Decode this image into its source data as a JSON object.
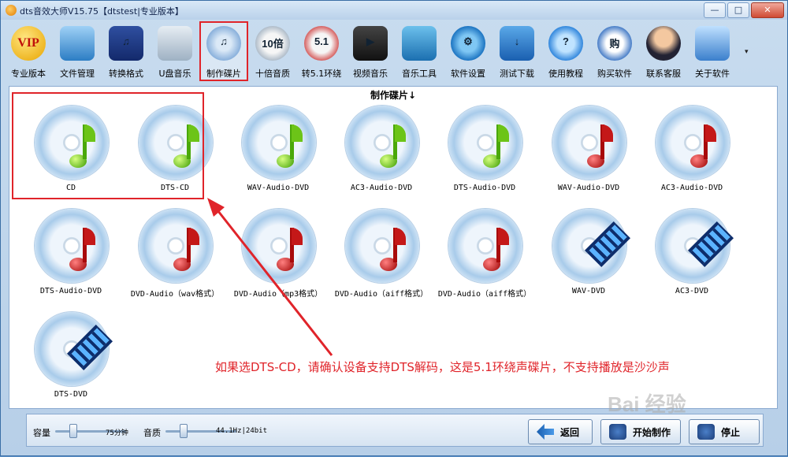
{
  "window": {
    "title": "dts音效大师V15.75【dtstest|专业版本】",
    "min_label": "—",
    "max_label": "□",
    "close_label": "✕"
  },
  "toolbar": {
    "items": [
      {
        "label": "专业版本",
        "icon": "vip-icon",
        "glyph": "VIP"
      },
      {
        "label": "文件管理",
        "icon": "folder-icon",
        "glyph": ""
      },
      {
        "label": "转换格式",
        "icon": "music-file-icon",
        "glyph": "♫"
      },
      {
        "label": "U盘音乐",
        "icon": "usb-icon",
        "glyph": ""
      },
      {
        "label": "制作碟片",
        "icon": "cd-music-icon",
        "glyph": "♫"
      },
      {
        "label": "十倍音质",
        "icon": "ten-times-icon",
        "glyph": "10倍"
      },
      {
        "label": "转5.1环绕",
        "icon": "surround-51-icon",
        "glyph": "5.1"
      },
      {
        "label": "视频音乐",
        "icon": "clapper-icon",
        "glyph": "▶"
      },
      {
        "label": "音乐工具",
        "icon": "tools-icon",
        "glyph": ""
      },
      {
        "label": "软件设置",
        "icon": "gear-icon",
        "glyph": "⚙"
      },
      {
        "label": "测试下载",
        "icon": "download-icon",
        "glyph": "↓"
      },
      {
        "label": "使用教程",
        "icon": "help-icon",
        "glyph": "?"
      },
      {
        "label": "购买软件",
        "icon": "buy-icon",
        "glyph": "购"
      },
      {
        "label": "联系客服",
        "icon": "headset-icon",
        "glyph": ""
      },
      {
        "label": "关于软件",
        "icon": "computer-icon",
        "glyph": ""
      }
    ],
    "dropdown_glyph": "▾"
  },
  "panel": {
    "title": "制作碟片↓",
    "discs": [
      {
        "caption": "CD",
        "kind": "green"
      },
      {
        "caption": "DTS-CD",
        "kind": "green"
      },
      {
        "caption": "WAV-Audio-DVD",
        "kind": "green"
      },
      {
        "caption": "AC3-Audio-DVD",
        "kind": "green"
      },
      {
        "caption": "DTS-Audio-DVD",
        "kind": "green"
      },
      {
        "caption": "WAV-Audio-DVD",
        "kind": "red"
      },
      {
        "caption": "AC3-Audio-DVD",
        "kind": "red"
      },
      {
        "caption": "DTS-Audio-DVD",
        "kind": "red"
      },
      {
        "caption": "DVD-Audio（wav格式）",
        "kind": "red"
      },
      {
        "caption": "DVD-Audio（mp3格式）",
        "kind": "red"
      },
      {
        "caption": "DVD-Audio（aiff格式）",
        "kind": "red"
      },
      {
        "caption": "DVD-Audio（aiff格式）",
        "kind": "red"
      },
      {
        "caption": "WAV-DVD",
        "kind": "film"
      },
      {
        "caption": "AC3-DVD",
        "kind": "film"
      },
      {
        "caption": "DTS-DVD",
        "kind": "film"
      }
    ]
  },
  "annotation": {
    "text": "如果选DTS-CD，请确认设备支持DTS解码，这是5.1环绕声碟片，不支持播放是沙沙声",
    "color": "#e0242a"
  },
  "bottom": {
    "capacity_label": "容量",
    "capacity_value": "75分钟",
    "quality_label": "音质",
    "quality_value": "44.1Hz|24bit",
    "back_label": "返回",
    "start_label": "开始制作",
    "stop_label": "停止"
  },
  "watermark": "Bai 经验"
}
